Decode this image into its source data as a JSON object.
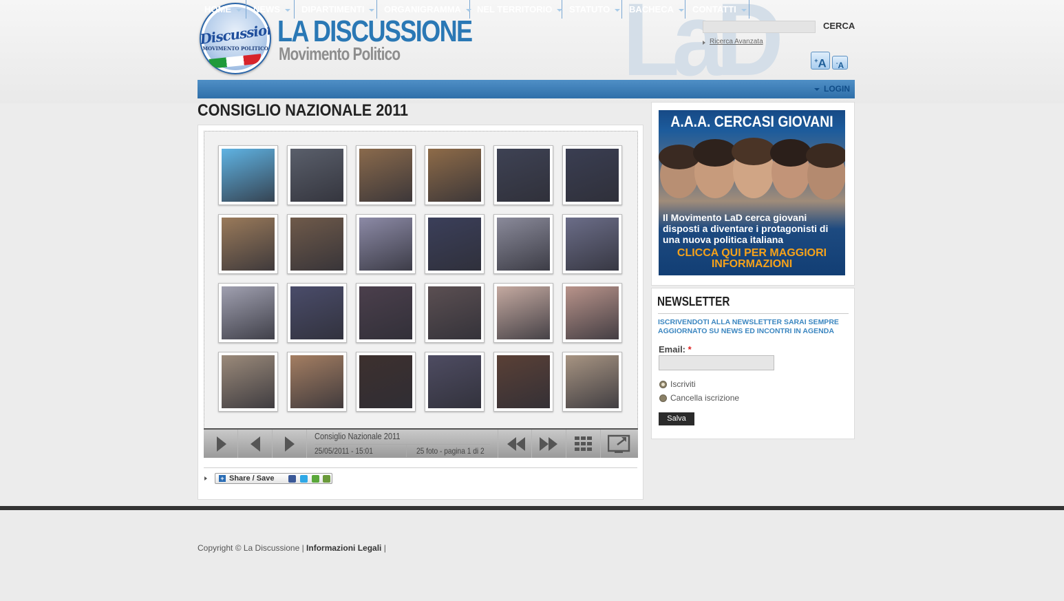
{
  "header": {
    "logo_word": "Discussione",
    "logo_sub": "MOVIMENTO POLITICO",
    "title": "LA DISCUSSIONE",
    "subtitle": "Movimento Politico",
    "watermark": "LaD",
    "search_button": "CERCA",
    "search_value": "",
    "advanced_search": "Ricerca Avanzata",
    "font_larger": "A",
    "font_smaller": "A"
  },
  "nav": {
    "items": [
      "HOME",
      "NEWS",
      "DIPARTIMENTI",
      "ORGANIGRAMMA",
      "NEL TERRITORIO",
      "STATUTO",
      "BACHECA",
      "CONTATTI"
    ],
    "login": "LOGIN"
  },
  "page": {
    "title": "CONSIGLIO NAZIONALE 2011"
  },
  "gallery": {
    "album_title": "Consiglio Nazionale 2011",
    "date": "25/05/2011 - 15:01",
    "count": "25 foto  -  pagina 1 di 2",
    "thumb_colors": [
      "#5fb3e3",
      "#5a5f6b",
      "#8a6a4c",
      "#8e6b48",
      "#3e4254",
      "#3a3e52",
      "#9a7a5a",
      "#6f5a4a",
      "#8c8aa6",
      "#3b3f5a",
      "#8a8a9a",
      "#6b6d88",
      "#a0a0b0",
      "#4a4c6a",
      "#4b3f4c",
      "#5b4f52",
      "#c4a9a0",
      "#b8938a",
      "#9b8a7a",
      "#a47e62",
      "#3d302e",
      "#4e4c62",
      "#5a4036",
      "#a79482"
    ],
    "controls": [
      "play",
      "previous",
      "next",
      "first",
      "last",
      "grid",
      "fullscreen"
    ]
  },
  "share": {
    "label": "Share / Save"
  },
  "promo": {
    "headline": "A.A.A. CERCASI GIOVANI",
    "body": "Il Movimento LaD cerca giovani disposti a diventare i protagonisti di una nuova politica italiana",
    "cta": "CLICCA QUI PER MAGGIORI INFORMAZIONI"
  },
  "newsletter": {
    "title": "NEWSLETTER",
    "description": "ISCRIVENDOTI ALLA NEWSLETTER SARAI SEMPRE AGGIORNATO SU NEWS ED INCONTRI IN AGENDA",
    "email_label": "Email:",
    "required_mark": "*",
    "email_value": "",
    "options": [
      "Iscriviti",
      "Cancella iscrizione"
    ],
    "selected": "Iscriviti",
    "save": "Salva"
  },
  "footer": {
    "copyright": "Copyright © La Discussione |",
    "legal": "Informazioni Legali",
    "trailing": "|"
  }
}
